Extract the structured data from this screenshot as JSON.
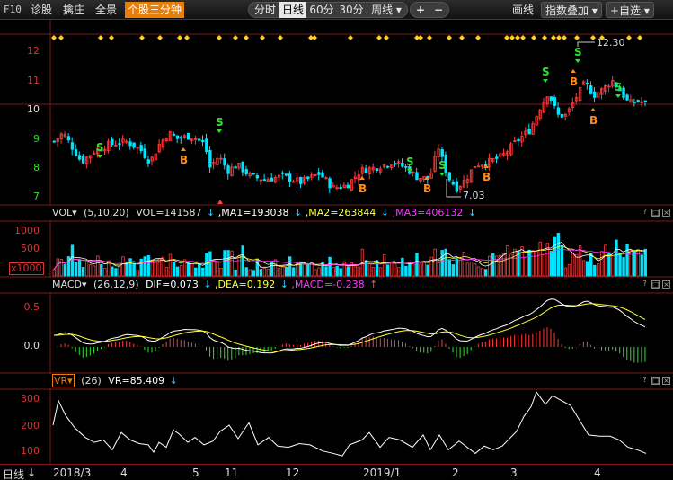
{
  "toolbar": {
    "f10": "F10",
    "diag": "诊股",
    "zhuang": "擒庄",
    "quanjing": "全景",
    "active_tab": "个股三分钟",
    "periods": [
      "分时",
      "日线",
      "60分",
      "30分"
    ],
    "period_selected": 1,
    "week": "周线 ▾",
    "plus": "+",
    "minus": "−",
    "huaxian": "画线",
    "indicator_overlay": "指数叠加 ▾",
    "add_watch": "+自选 ▾"
  },
  "price_axis": {
    "labels": [
      "12",
      "11",
      "10",
      "9",
      "8",
      "7"
    ],
    "low_marker": "7.03",
    "high_marker": "12.30"
  },
  "vol_header": {
    "name": "VOL▾",
    "params": "(5,10,20)",
    "vol": "VOL=141587",
    "arrow1": "↓",
    "ma1": ",MA1=193038",
    "arrow2": "↓",
    "ma2": ",MA2=263844",
    "arrow3": "↓",
    "ma3": ",MA3=406132",
    "arrow4": "↓"
  },
  "vol_axis": {
    "labels": [
      "1000",
      "500"
    ],
    "unit": "x1000"
  },
  "macd_header": {
    "name": "MACD▾",
    "params": "(26,12,9)",
    "dif": "DIF=0.073",
    "arrow1": "↓",
    "dea": ",DEA=0.192",
    "arrow2": "↓",
    "macd": ",MACD=-0.238",
    "arrow3": "↑"
  },
  "macd_axis": {
    "labels": [
      "0.5",
      "0.0"
    ]
  },
  "vr_header": {
    "name": "VR▾",
    "params": "(26)",
    "vr": "VR=85.409",
    "arrow": "↓"
  },
  "vr_axis": {
    "labels": [
      "300",
      "200",
      "100"
    ]
  },
  "window_btns": [
    "?",
    "□",
    "×"
  ],
  "footer": {
    "period": "日线",
    "arrow": "↓",
    "dates": [
      "2018/3",
      "4",
      "5",
      "11",
      "12",
      "2019/1",
      "2",
      "3",
      "4"
    ]
  },
  "colors": {
    "up": "#ff3b3b",
    "down": "#00e5ff",
    "accent": "#e87e0a",
    "ma1": "#ffffff",
    "ma2": "#ffff33",
    "ma3": "#ff33ff"
  }
}
